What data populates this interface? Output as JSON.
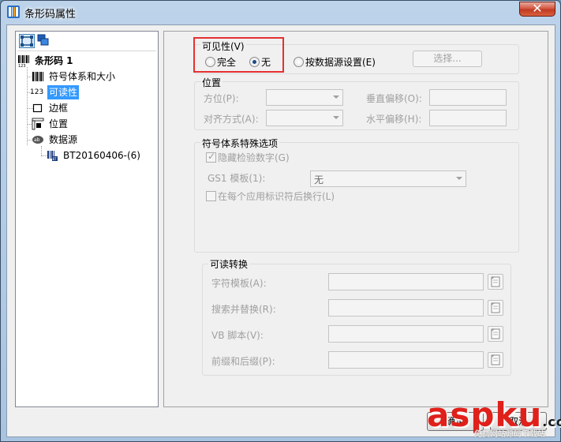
{
  "window": {
    "title": "条形码属性",
    "close_glyph": "✕"
  },
  "toolbar": {
    "icons": [
      "object-layout-icon",
      "layers-icon"
    ]
  },
  "tree": {
    "root": "条形码 1",
    "items": [
      {
        "label": "符号体系和大小",
        "icon": "barcode-icon"
      },
      {
        "label": "可读性",
        "icon": "readable-123-icon",
        "selected": true,
        "icon_text": "123"
      },
      {
        "label": "边框",
        "icon": "border-square-icon"
      },
      {
        "label": "位置",
        "icon": "position-ruler-icon"
      },
      {
        "label": "数据源",
        "icon": "datasource-icon"
      }
    ],
    "child": "BT20160406-(6)"
  },
  "visibility": {
    "title": "可见性(V)",
    "options": [
      {
        "label": "完全",
        "selected": false
      },
      {
        "label": "无",
        "selected": true
      },
      {
        "label": "按数据源设置(E)",
        "selected": false
      }
    ],
    "select_button": "选择..."
  },
  "position": {
    "title": "位置",
    "orientation_label": "方位(P):",
    "vertical_offset_label": "垂直偏移(O):",
    "alignment_label": "对齐方式(A):",
    "horizontal_offset_label": "水平偏移(H):"
  },
  "symbology_options": {
    "title": "符号体系特殊选项",
    "hide_check_digit": "隐藏检验数字(G)",
    "gs1_template_label": "GS1 模板(1):",
    "gs1_template_value": "无",
    "newline_after_ai": "在每个应用标识符后换行(L)"
  },
  "readable_conversion": {
    "title": "可读转换",
    "fields": [
      {
        "label": "字符模板(A):"
      },
      {
        "label": "搜索并替换(R):"
      },
      {
        "label": "VB 脚本(V):"
      },
      {
        "label": "前缀和后缀(P):"
      }
    ]
  },
  "footer": {
    "ok": "确定",
    "cancel": "取消"
  },
  "watermark": {
    "main": "aspku",
    "tld": ".com",
    "sub": "免费网站源码下载站"
  },
  "colors": {
    "highlight": "#3399ff",
    "annotation_red": "#e53030",
    "title_bar": "#bcd3ea"
  }
}
